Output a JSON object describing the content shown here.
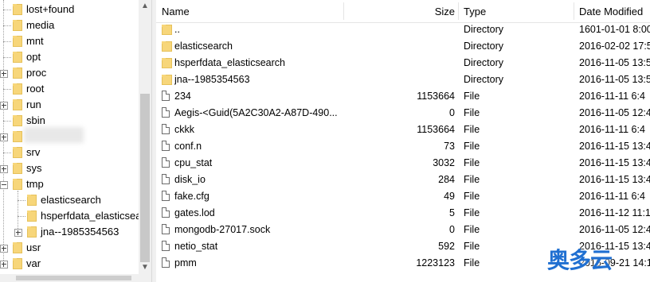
{
  "tree": {
    "items": [
      {
        "label": "lost+found",
        "expandable": false
      },
      {
        "label": "media",
        "expandable": false
      },
      {
        "label": "mnt",
        "expandable": false
      },
      {
        "label": "opt",
        "expandable": false
      },
      {
        "label": "proc",
        "expandable": true
      },
      {
        "label": "root",
        "expandable": false
      },
      {
        "label": "run",
        "expandable": true
      },
      {
        "label": "sbin",
        "expandable": false
      },
      {
        "label": "",
        "expandable": true
      },
      {
        "label": "srv",
        "expandable": false
      },
      {
        "label": "sys",
        "expandable": true
      },
      {
        "label": "tmp",
        "expandable": true
      },
      {
        "label": "elasticsearch",
        "expandable": false
      },
      {
        "label": "hsperfdata_elasticsearch",
        "expandable": false
      },
      {
        "label": "jna--1985354563",
        "expandable": true
      },
      {
        "label": "usr",
        "expandable": true
      },
      {
        "label": "var",
        "expandable": true
      }
    ],
    "scroll_up_icon": "triangle-up",
    "scroll_down_icon": "triangle-down"
  },
  "list": {
    "columns": {
      "name": "Name",
      "size": "Size",
      "type": "Type",
      "date": "Date Modified"
    },
    "rows": [
      {
        "icon": "folder",
        "name": "..",
        "size": "",
        "type": "Directory",
        "date": "1601-01-01 8:00"
      },
      {
        "icon": "folder",
        "name": "elasticsearch",
        "size": "",
        "type": "Directory",
        "date": "2016-02-02 17:5"
      },
      {
        "icon": "folder",
        "name": "hsperfdata_elasticsearch",
        "size": "",
        "type": "Directory",
        "date": "2016-11-05 13:5"
      },
      {
        "icon": "folder",
        "name": "jna--1985354563",
        "size": "",
        "type": "Directory",
        "date": "2016-11-05 13:5"
      },
      {
        "icon": "file",
        "name": "234",
        "size": "1153664",
        "type": "File",
        "date": "2016-11-11 6:4"
      },
      {
        "icon": "file",
        "name": "Aegis-<Guid(5A2C30A2-A87D-490...",
        "size": "0",
        "type": "File",
        "date": "2016-11-05 12:4"
      },
      {
        "icon": "file",
        "name": "ckkk",
        "size": "1153664",
        "type": "File",
        "date": "2016-11-11 6:4"
      },
      {
        "icon": "file",
        "name": "conf.n",
        "size": "73",
        "type": "File",
        "date": "2016-11-15 13:4"
      },
      {
        "icon": "file",
        "name": "cpu_stat",
        "size": "3032",
        "type": "File",
        "date": "2016-11-15 13:4"
      },
      {
        "icon": "file",
        "name": "disk_io",
        "size": "284",
        "type": "File",
        "date": "2016-11-15 13:4"
      },
      {
        "icon": "file",
        "name": "fake.cfg",
        "size": "49",
        "type": "File",
        "date": "2016-11-11 6:4"
      },
      {
        "icon": "file",
        "name": "gates.lod",
        "size": "5",
        "type": "File",
        "date": "2016-11-12 11:1"
      },
      {
        "icon": "file",
        "name": "mongodb-27017.sock",
        "size": "0",
        "type": "File",
        "date": "2016-11-05 12:4"
      },
      {
        "icon": "file",
        "name": "netio_stat",
        "size": "592",
        "type": "File",
        "date": "2016-11-15 13:4"
      },
      {
        "icon": "file",
        "name": "pmm",
        "size": "1223123",
        "type": "File",
        "date": "2016-09-21 14:1"
      }
    ]
  },
  "watermark": {
    "text": "奥多云",
    "color": "#1f6fd1"
  }
}
